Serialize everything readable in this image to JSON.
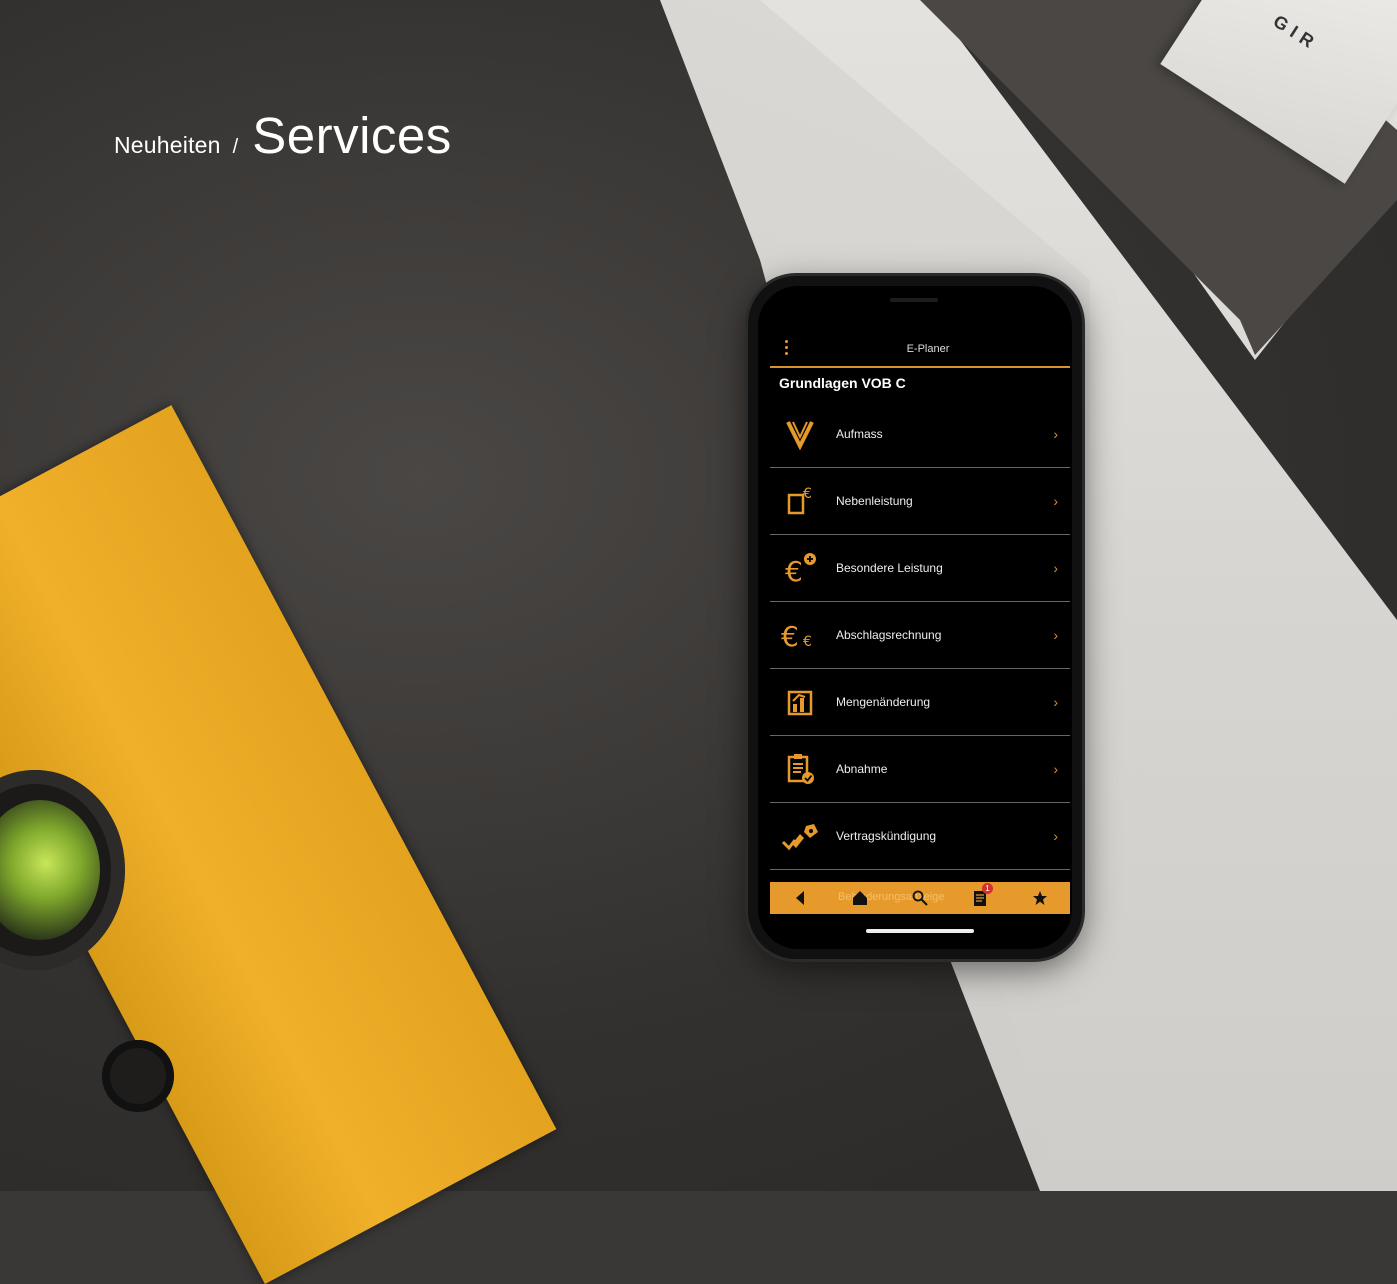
{
  "heading": {
    "breadcrumb": "Neuheiten",
    "separator": "/",
    "title": "Services"
  },
  "background_box": {
    "text": "GIR"
  },
  "app": {
    "title": "E-Planer",
    "section_title": "Grundlagen VOB C",
    "accent_color": "#e79a2c",
    "items": [
      {
        "label": "Aufmass",
        "icon": "measure-v-icon"
      },
      {
        "label": "Nebenleistung",
        "icon": "document-euro-icon"
      },
      {
        "label": "Besondere Leistung",
        "icon": "euro-plus-icon"
      },
      {
        "label": "Abschlagsrechnung",
        "icon": "euro-double-icon"
      },
      {
        "label": "Mengenänderung",
        "icon": "chart-up-icon"
      },
      {
        "label": "Abnahme",
        "icon": "clipboard-check-icon"
      },
      {
        "label": "Vertragskündigung",
        "icon": "contract-cancel-icon"
      }
    ],
    "partial_item_label": "Behinderungsanzeige",
    "chevron": "›",
    "bottom_nav": [
      {
        "name": "back-icon"
      },
      {
        "name": "home-icon"
      },
      {
        "name": "search-icon"
      },
      {
        "name": "notes-icon",
        "badge": "1"
      },
      {
        "name": "favorites-icon"
      }
    ]
  }
}
